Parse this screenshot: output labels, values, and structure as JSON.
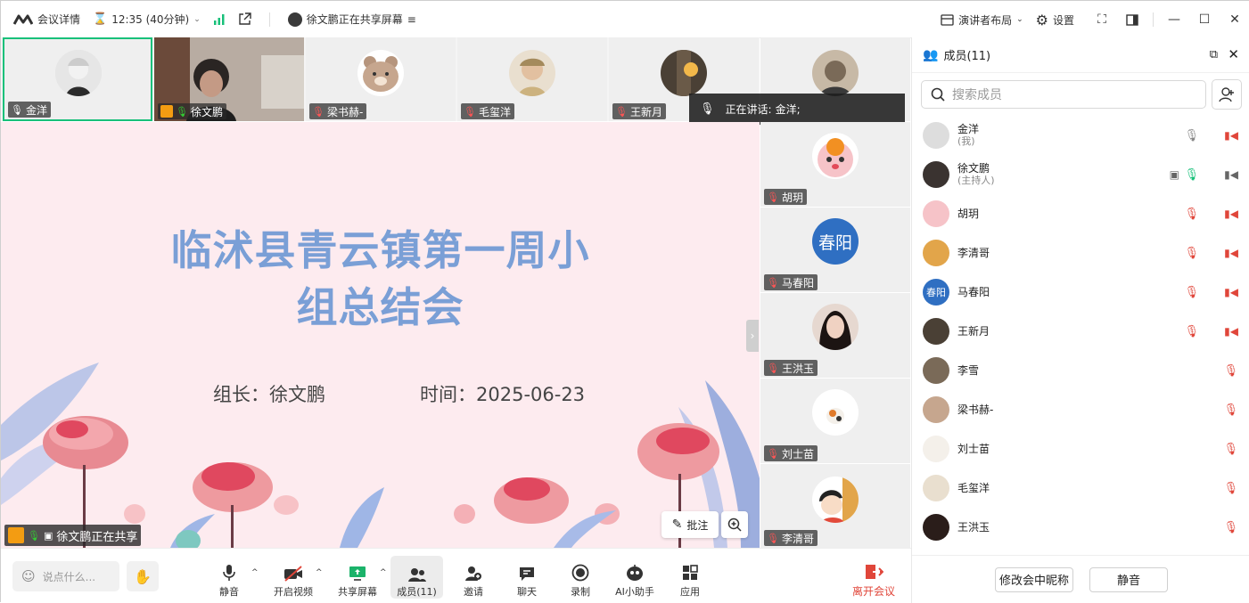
{
  "topbar": {
    "meeting_info": "会议详情",
    "timer": "12:35 (40分钟)",
    "sharing_status": "徐文鹏正在共享屏幕",
    "layout": "演讲者布局",
    "settings": "设置"
  },
  "speaking": {
    "label": "正在讲话:",
    "name": "金洋;"
  },
  "thumbnails": [
    {
      "name": "金洋"
    },
    {
      "name": "徐文鹏"
    },
    {
      "name": "梁书赫-"
    },
    {
      "name": "毛玺洋"
    },
    {
      "name": "王新月"
    },
    {
      "name": ""
    }
  ],
  "side_thumbnails": [
    {
      "name": "胡玥"
    },
    {
      "name": "马春阳",
      "avatar_text": "春阳"
    },
    {
      "name": "王洪玉"
    },
    {
      "name": "刘士苗"
    },
    {
      "name": "李清哥"
    }
  ],
  "slide": {
    "title_line1": "临沭县青云镇第一周小",
    "title_line2": "组总结会",
    "leader": "组长：徐文鹏",
    "time": "时间：2025-06-23"
  },
  "share": {
    "annotate": "批注",
    "sharer_tag": "徐文鹏正在共享"
  },
  "panel": {
    "title": "成员(11)",
    "search_placeholder": "搜索成员",
    "members": [
      {
        "name": "金洋",
        "role": "(我)"
      },
      {
        "name": "徐文鹏",
        "role": "(主持人)"
      },
      {
        "name": "胡玥",
        "role": ""
      },
      {
        "name": "李清哥",
        "role": ""
      },
      {
        "name": "马春阳",
        "role": "",
        "avatar_text": "春阳"
      },
      {
        "name": "王新月",
        "role": ""
      },
      {
        "name": "李雪",
        "role": ""
      },
      {
        "name": "梁书赫-",
        "role": ""
      },
      {
        "name": "刘士苗",
        "role": ""
      },
      {
        "name": "毛玺洋",
        "role": ""
      },
      {
        "name": "王洪玉",
        "role": ""
      }
    ],
    "rename": "修改会中昵称",
    "mute": "静音"
  },
  "toolbar": {
    "chat_placeholder": "说点什么...",
    "mute": "静音",
    "video": "开启视频",
    "share": "共享屏幕",
    "members": "成员(11)",
    "invite": "邀请",
    "chat": "聊天",
    "record": "录制",
    "ai": "AI小助手",
    "apps": "应用",
    "leave": "离开会议"
  },
  "colors": {
    "accent": "#18c07a",
    "leave": "#e0463a",
    "slide_title": "#7a9fd6",
    "slide_bg": "#fdebef"
  }
}
